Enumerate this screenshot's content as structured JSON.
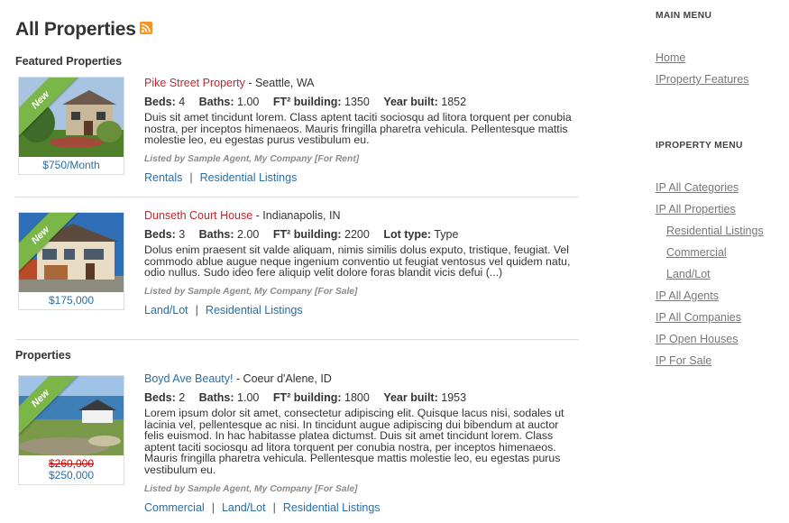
{
  "page": {
    "title": "All Properties",
    "rss_icon": "rss-icon"
  },
  "featured_heading": "Featured Properties",
  "properties_heading": "Properties",
  "listings": [
    {
      "title": "Pike Street Property",
      "location": " - Seattle, WA",
      "badge": "New",
      "price": "$750/Month",
      "old_price": "",
      "stats": [
        {
          "label": "Beds:",
          "value": "4"
        },
        {
          "label": "Baths:",
          "value": "1.00"
        },
        {
          "label": "FT² building:",
          "value": "1350"
        },
        {
          "label": "Year built:",
          "value": "1852"
        }
      ],
      "description": "Duis sit amet tincidunt lorem. Class aptent taciti sociosqu ad litora torquent per conubia nostra, per inceptos himenaeos. Mauris fringilla pharetra vehicula. Pellentesque mattis molestie leo, eu egestas purus vestibulum eu.",
      "agent": "Listed by Sample Agent, My Company [For Rent]",
      "categories": [
        "Rentals",
        "Residential Listings"
      ]
    },
    {
      "title": "Dunseth Court House",
      "location": " - Indianapolis, IN",
      "badge": "New",
      "price": "$175,000",
      "old_price": "",
      "stats": [
        {
          "label": "Beds:",
          "value": "3"
        },
        {
          "label": "Baths:",
          "value": "2.00"
        },
        {
          "label": "FT² building:",
          "value": "2200"
        },
        {
          "label": "Lot type:",
          "value": "Type"
        }
      ],
      "description": "Dolus enim praesent sit valde aliquam, nimis similis dolus exputo, tristique, feugiat. Vel commodo ablue augue neque ingenium conventio ut feugiat ventosus vel quidem natu, odio nullus. Sudo ideo fere aliquip velit dolore foras blandit vicis defui (...)",
      "agent": "Listed by Sample Agent, My Company [For Sale]",
      "categories": [
        "Land/Lot",
        "Residential Listings"
      ]
    },
    {
      "title": "Boyd Ave Beauty!",
      "location": " - Coeur d'Alene, ID",
      "badge": "New",
      "price": "$250,000",
      "old_price": "$260,000",
      "stats": [
        {
          "label": "Beds:",
          "value": "2"
        },
        {
          "label": "Baths:",
          "value": "1.00"
        },
        {
          "label": "FT² building:",
          "value": "1800"
        },
        {
          "label": "Year built:",
          "value": "1953"
        }
      ],
      "description": "Lorem ipsum dolor sit amet, consectetur adipiscing elit. Quisque lacus nisi, sodales ut lacinia vel, pellentesque ac nisi. In tincidunt augue adipiscing dui bibendum at auctor felis euismod. In hac habitasse platea dictumst. Duis sit amet tincidunt lorem. Class aptent taciti sociosqu ad litora torquent per conubia nostra, per inceptos himenaeos. Mauris fringilla pharetra vehicula. Pellentesque mattis molestie leo, eu egestas purus vestibulum eu.",
      "agent": "Listed by Sample Agent, My Company [For Sale]",
      "categories": [
        "Commercial",
        "Land/Lot",
        "Residential Listings"
      ]
    }
  ],
  "sidebar": {
    "main_menu": {
      "heading": "MAIN MENU",
      "items": [
        "Home",
        "IProperty Features"
      ]
    },
    "iproperty_menu": {
      "heading": "IPROPERTY MENU",
      "items": [
        {
          "label": "IP All Categories",
          "sub": false
        },
        {
          "label": "IP All Properties",
          "sub": false
        },
        {
          "label": "Residential Listings",
          "sub": true
        },
        {
          "label": "Commercial",
          "sub": true
        },
        {
          "label": "Land/Lot",
          "sub": true
        },
        {
          "label": "IP All Agents",
          "sub": false
        },
        {
          "label": "IP All Companies",
          "sub": false
        },
        {
          "label": "IP Open Houses",
          "sub": false
        },
        {
          "label": "IP For Sale",
          "sub": false
        }
      ]
    }
  },
  "colors": {
    "featured_title": "#c0282d",
    "regular_title": "#2a6ea8",
    "link": "#2a6ea8",
    "badge": "#7ab648",
    "old_price": "#cc0000"
  }
}
